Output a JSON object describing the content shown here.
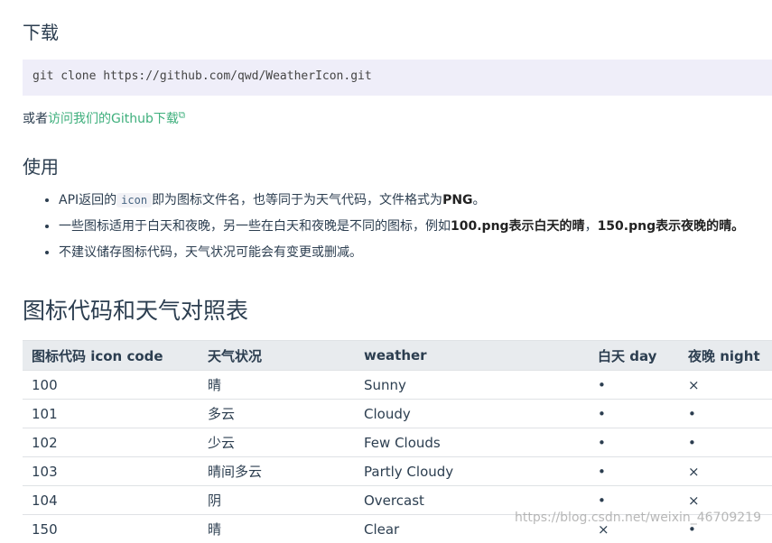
{
  "headings": {
    "download": "下载",
    "usage": "使用",
    "table": "图标代码和天气对照表"
  },
  "code_block": "git clone https://github.com/qwd/WeatherIcon.git",
  "alt_line": {
    "prefix": "或者",
    "link": "访问我们的Github下载",
    "ext_icon": "external-link-icon"
  },
  "usage_items": [
    {
      "a": "API返回的",
      "code": "icon",
      "b": "即为图标文件名，也等同于为天气代码，文件格式为",
      "bold": "PNG",
      "c": "。"
    },
    {
      "a": "一些图标适用于白天和夜晚，另一些在白天和夜晚是不同的图标，例如",
      "bold": "100.png表示白天的晴",
      "b": "，",
      "bold2": "150.png表示夜晚的晴",
      "c": "。"
    },
    {
      "a": "不建议储存图标代码，天气状况可能会有变更或删减。"
    }
  ],
  "table": {
    "headers": [
      "图标代码 icon code",
      "天气状况",
      "weather",
      "白天 day",
      "夜晚 night"
    ],
    "rows": [
      [
        "100",
        "晴",
        "Sunny",
        "•",
        "×"
      ],
      [
        "101",
        "多云",
        "Cloudy",
        "•",
        "•"
      ],
      [
        "102",
        "少云",
        "Few Clouds",
        "•",
        "•"
      ],
      [
        "103",
        "晴间多云",
        "Partly Cloudy",
        "•",
        "×"
      ],
      [
        "104",
        "阴",
        "Overcast",
        "•",
        "×"
      ],
      [
        "150",
        "晴",
        "Clear",
        "×",
        "•"
      ]
    ]
  },
  "watermark": "https://blog.csdn.net/weixin_46709219"
}
